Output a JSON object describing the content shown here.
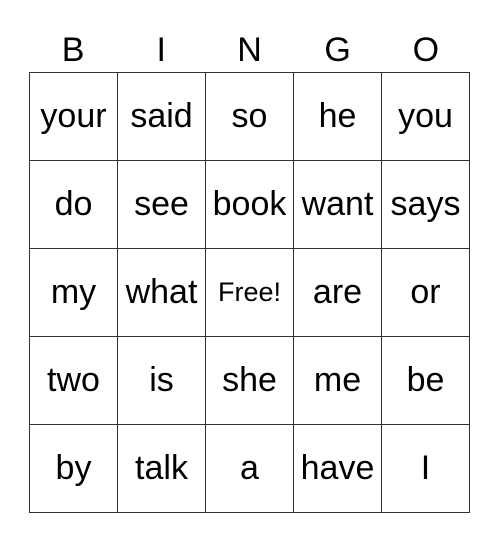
{
  "header": [
    "B",
    "I",
    "N",
    "G",
    "O"
  ],
  "grid": [
    [
      "your",
      "said",
      "so",
      "he",
      "you"
    ],
    [
      "do",
      "see",
      "book",
      "want",
      "says"
    ],
    [
      "my",
      "what",
      "Free!",
      "are",
      "or"
    ],
    [
      "two",
      "is",
      "she",
      "me",
      "be"
    ],
    [
      "by",
      "talk",
      "a",
      "have",
      "I"
    ]
  ]
}
